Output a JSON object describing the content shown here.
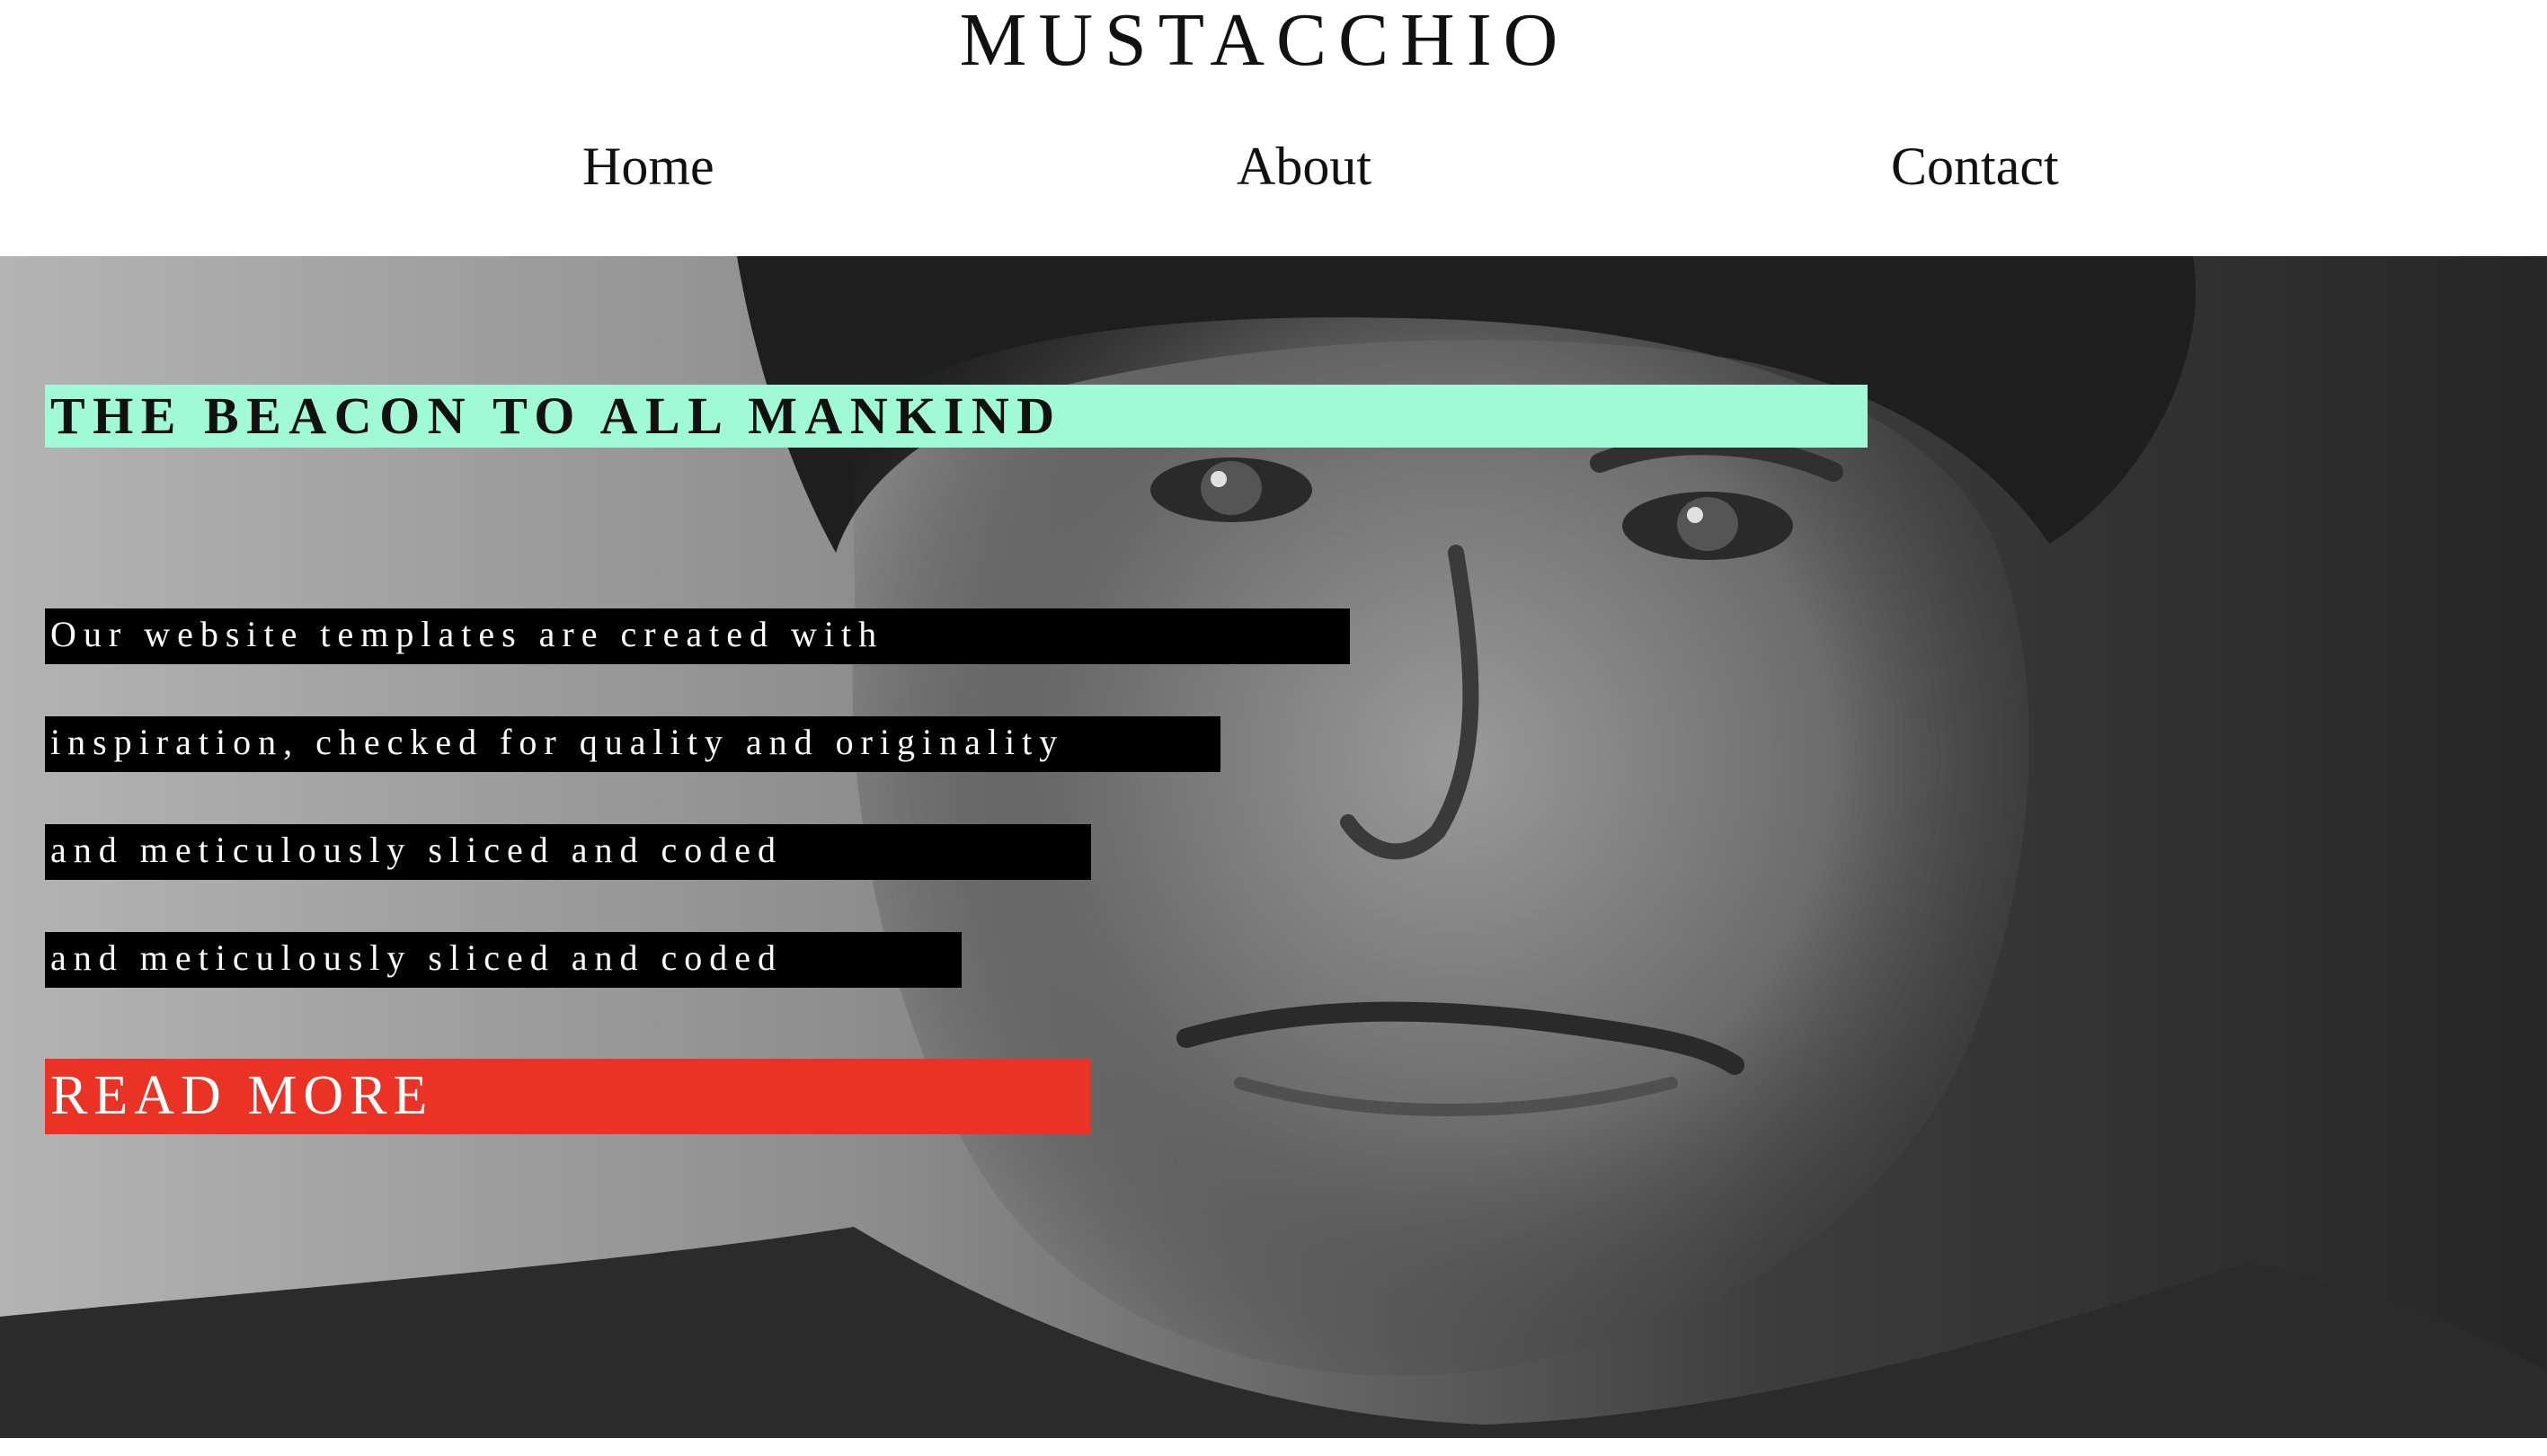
{
  "header": {
    "brand": "MUSTACCHIO",
    "nav": [
      {
        "label": "Home"
      },
      {
        "label": "About"
      },
      {
        "label": "Contact"
      }
    ]
  },
  "hero": {
    "headline": "THE BEACON TO ALL MANKIND",
    "body_lines": [
      "Our website templates are created with",
      "inspiration, checked for quality and originality",
      "and meticulously sliced and coded",
      "and meticulously sliced and coded"
    ],
    "cta_label": "READ MORE"
  },
  "colors": {
    "headline_band": "#a1fad6",
    "body_band": "#000000",
    "cta_band": "#ea3324",
    "text_dark": "#111111",
    "text_light": "#ffffff"
  }
}
